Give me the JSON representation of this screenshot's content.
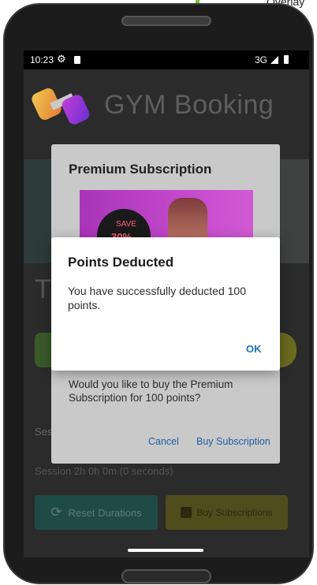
{
  "device": {
    "overlay_label": "Overlay"
  },
  "status_bar": {
    "time": "10:23",
    "network": "3G"
  },
  "app": {
    "title": "GYM Booking",
    "behind_heading_initial": "T",
    "behind_text_1": "Ses",
    "behind_text_2": "Session 2h 0h 0m (0 seconds)",
    "reset_button_label": "Reset Durations",
    "buy_subscriptions_label": "Buy Subscriptions"
  },
  "premium_dialog": {
    "title": "Premium Subscription",
    "promo_save": "SAVE",
    "promo_percent": "30%",
    "question": "Would you like to buy the Premium Subscription for 100 points?",
    "cancel_label": "Cancel",
    "buy_label": "Buy Subscription"
  },
  "points_dialog": {
    "title": "Points Deducted",
    "message": "You have successfully deducted 100 points.",
    "ok_label": "OK"
  },
  "colors": {
    "accent": "#1d73c7",
    "dim_overlay": "#000000",
    "reset_button": "#1f4b47",
    "buy_button": "#514c1c"
  }
}
